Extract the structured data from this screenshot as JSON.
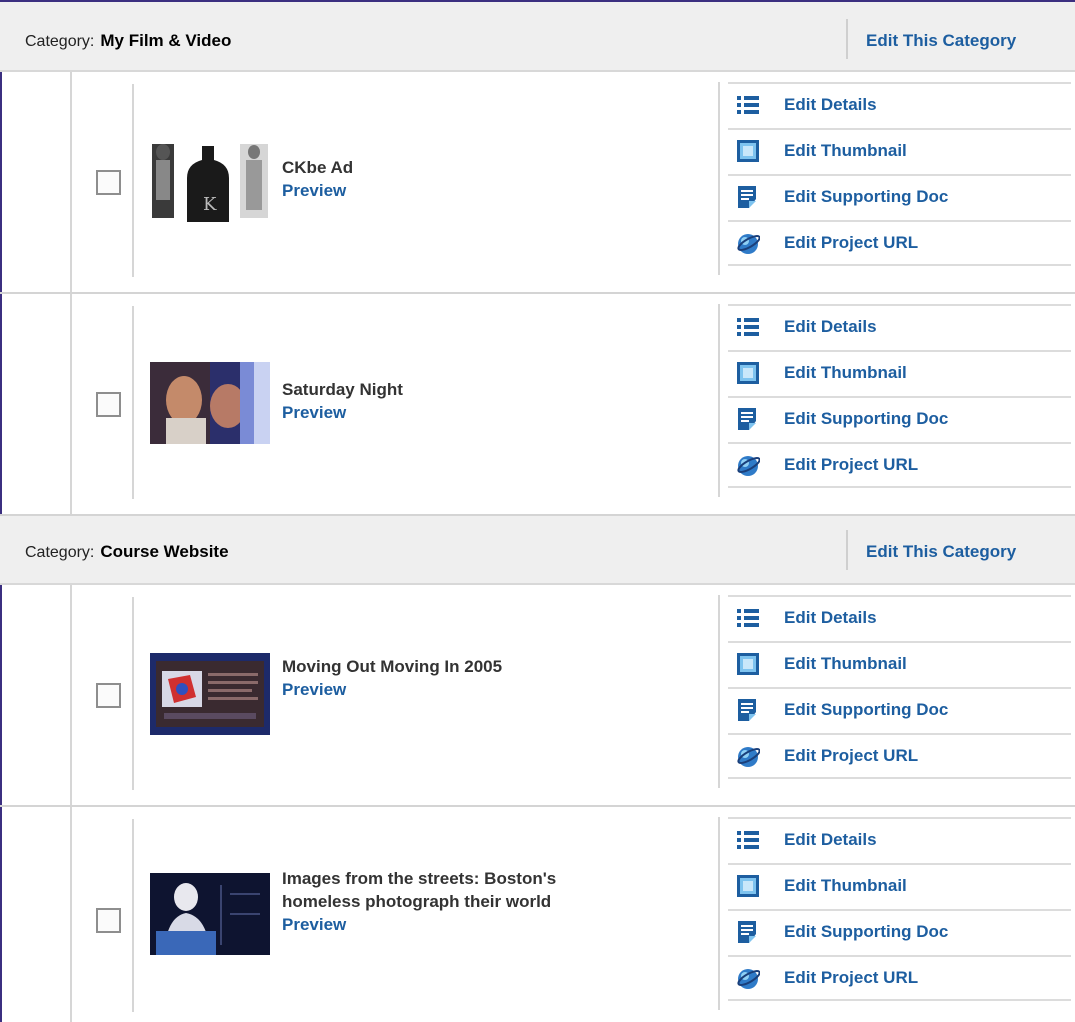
{
  "categories": [
    {
      "label": "Category:",
      "name": "My Film & Video",
      "edit_label": "Edit This Category",
      "items": [
        {
          "title_lines": [
            "CKbe Ad"
          ],
          "preview": "Preview",
          "thumb_icon": "ckbe-ad-thumbnail"
        },
        {
          "title_lines": [
            "Saturday Night"
          ],
          "preview": "Preview",
          "thumb_icon": "saturday-night-thumbnail"
        }
      ]
    },
    {
      "label": "Category:",
      "name": "Course Website",
      "edit_label": "Edit This Category",
      "items": [
        {
          "title_lines": [
            "Moving Out Moving In 2005"
          ],
          "preview": "Preview",
          "thumb_icon": "moving-out-thumbnail"
        },
        {
          "title_lines": [
            "Images from the streets: Boston's",
            "homeless photograph their world"
          ],
          "preview": "Preview",
          "thumb_icon": "images-streets-thumbnail"
        }
      ]
    }
  ],
  "actions": {
    "edit_details": "Edit Details",
    "edit_thumbnail": "Edit Thumbnail",
    "edit_supporting_doc": "Edit Supporting Doc",
    "edit_project_url": "Edit Project URL"
  },
  "icons": {
    "details": "list-icon",
    "thumbnail": "thumbnail-icon",
    "doc": "document-icon",
    "url": "globe-icon"
  },
  "colors": {
    "link": "#1d5ea0",
    "header_bg": "#efefef"
  }
}
